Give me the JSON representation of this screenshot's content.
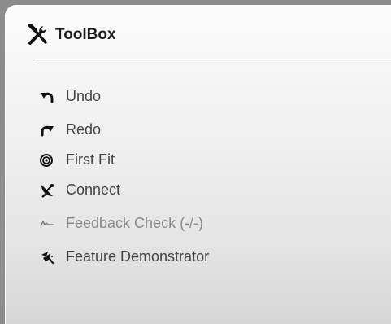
{
  "toolbox": {
    "title": "ToolBox",
    "title_icon": "tools-icon",
    "items": [
      {
        "label": "Undo",
        "icon": "undo-icon",
        "enabled": true
      },
      {
        "label": "Redo",
        "icon": "redo-icon",
        "enabled": true
      },
      {
        "label": "First Fit",
        "icon": "target-icon",
        "enabled": true
      },
      {
        "label": "Connect",
        "icon": "satellite-dish-icon",
        "enabled": true
      },
      {
        "label": "Feedback Check (-/-)",
        "icon": "waveform-icon",
        "enabled": false
      },
      {
        "label": "Feature Demonstrator",
        "icon": "magic-wand-icon",
        "enabled": true
      }
    ]
  },
  "colors": {
    "background": "#8c8c8c",
    "panel": "#f2f2f2",
    "text": "#444444",
    "text_disabled": "#8a8a8a",
    "title_text": "#1e1e1e"
  }
}
